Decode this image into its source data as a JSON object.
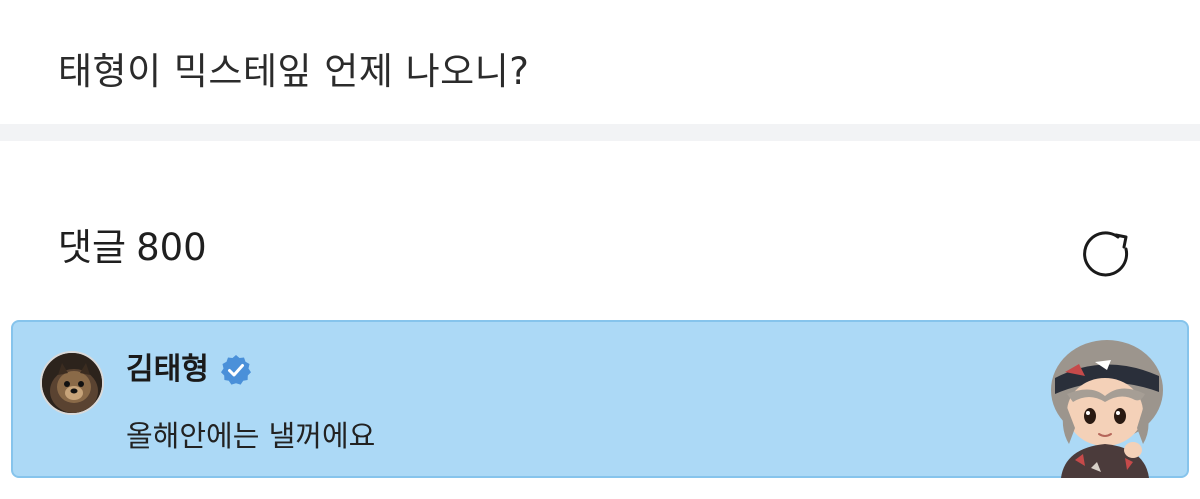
{
  "post": {
    "title": "태형이 믹스테잎 언제 나오니?"
  },
  "comments": {
    "label": "댓글",
    "count": "800",
    "refresh_icon": "refresh-icon"
  },
  "comment": {
    "author": "김태형",
    "verified_icon": "verified-badge-icon",
    "text": "올해안에는 낼꺼에요",
    "highlight_color": "#acd9f6",
    "verified_color": "#4a90d9"
  }
}
